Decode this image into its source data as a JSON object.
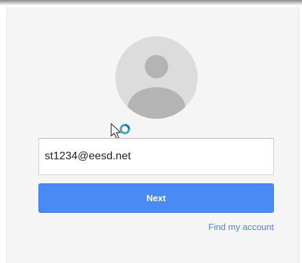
{
  "login": {
    "email_value": "st1234@eesd.net",
    "next_label": "Next",
    "find_account_label": "Find my account"
  },
  "colors": {
    "primary_button": "#4a8af4",
    "link": "#4a86e8",
    "card_background": "#f5f5f5"
  },
  "icons": {
    "avatar": "default-user-avatar-icon",
    "cursor": "busy-cursor-icon"
  }
}
